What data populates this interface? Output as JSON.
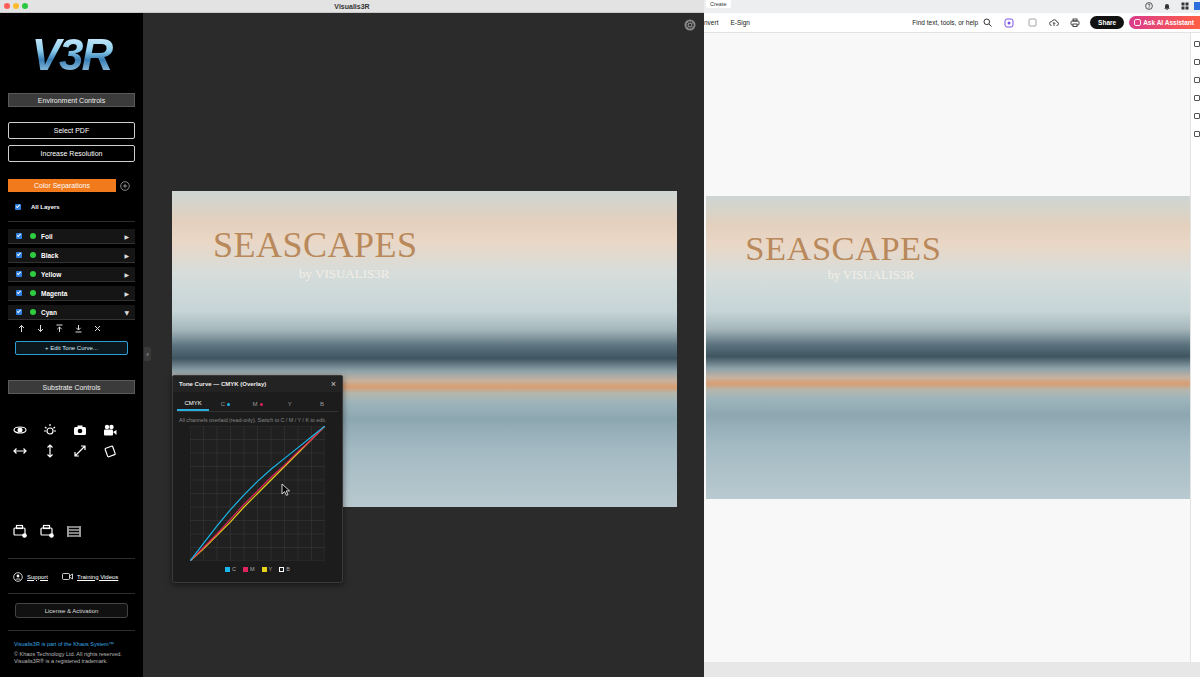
{
  "app": {
    "title": "Visualis3R",
    "logo": "V3R"
  },
  "sidebar": {
    "environment_controls": "Environment Controls",
    "buttons": [
      "Select PDF",
      "Increase Resolution"
    ],
    "color_separations": "Color Separations",
    "all_layers": {
      "label": "All Layers",
      "checked": true
    },
    "layers": [
      {
        "name": "Foil",
        "checked": true,
        "visible": true,
        "expanded": false,
        "arrow": "▶"
      },
      {
        "name": "Black",
        "checked": true,
        "visible": true,
        "expanded": false,
        "arrow": "▶"
      },
      {
        "name": "Yellow",
        "checked": true,
        "visible": true,
        "expanded": false,
        "arrow": "▶"
      },
      {
        "name": "Magenta",
        "checked": true,
        "visible": true,
        "expanded": false,
        "arrow": "▶"
      },
      {
        "name": "Cyan",
        "checked": true,
        "visible": true,
        "expanded": true,
        "arrow": "▼"
      }
    ],
    "edit_tone_curve": "+ Edit Tone Curve...",
    "substrate_controls": "Substrate Controls",
    "links": [
      "Support",
      "Training Videos"
    ],
    "license": "License & Activation",
    "footer": {
      "brand": "Visualis3R is part of the Khaos System™",
      "legal": "© Khaos Technology Ltd. All rights reserved. Visualis3R® is a registered trademark."
    }
  },
  "collapse_handle": "‹",
  "artwork": {
    "title": "SEASCAPES",
    "subtitle": "by VISUALIS3R"
  },
  "tone_curve": {
    "title": "Tone Curve — CMYK (Overlay)",
    "close": "×",
    "tabs": [
      {
        "label": "CMYK",
        "selected": true
      },
      {
        "label": "C",
        "selected": false,
        "color": "#1ab7ea"
      },
      {
        "label": "M",
        "selected": false,
        "color": "#e0245e"
      },
      {
        "label": "Y",
        "selected": false
      },
      {
        "label": "B",
        "selected": false
      }
    ],
    "hint": "All channels overlaid (read-only). Switch to C / M / Y / K to edit.",
    "series": [
      {
        "name": "Y",
        "color": "#e8d21a",
        "values": [
          0,
          9,
          19,
          29,
          40,
          50,
          60,
          70,
          80,
          90,
          100
        ]
      },
      {
        "name": "M",
        "color": "#e0245e",
        "values": [
          0,
          10,
          20,
          31,
          42,
          52,
          62,
          71,
          81,
          90,
          100
        ]
      },
      {
        "name": "C",
        "color": "#1ab7ea",
        "values": [
          0,
          13,
          26,
          38,
          49,
          59,
          68,
          76,
          84,
          92,
          100
        ]
      }
    ],
    "legend": [
      {
        "label": "C",
        "color": "#1ab7ea",
        "shown": true
      },
      {
        "label": "M",
        "color": "#e0245e",
        "shown": true
      },
      {
        "label": "Y",
        "color": "#e8d21a",
        "shown": true
      },
      {
        "label": "B",
        "color": "#ffffff",
        "shown": false
      }
    ]
  },
  "acrobat": {
    "top_tab": "Create",
    "menu": [
      "nvert",
      "E-Sign"
    ],
    "search": "Find text, tools, or help",
    "share": "Share",
    "ai_assistant": "Ask AI Assistant"
  }
}
